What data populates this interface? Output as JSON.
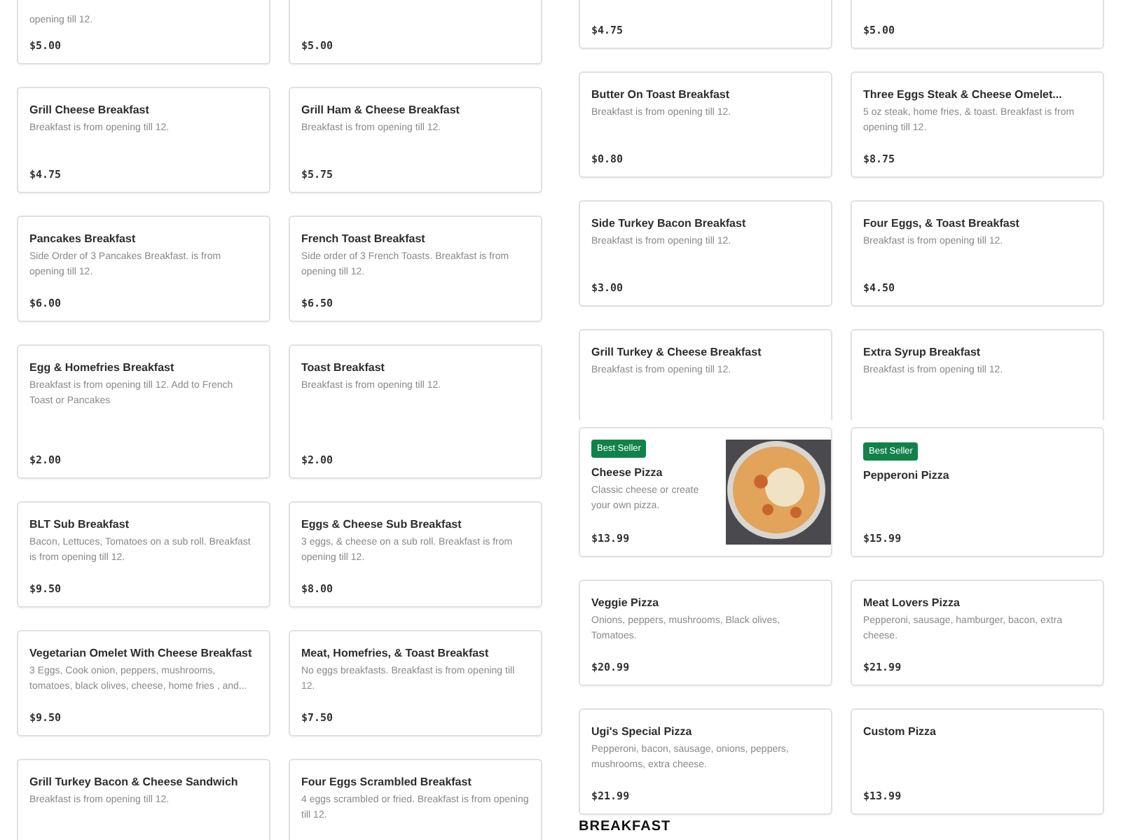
{
  "panels": [
    {
      "cards": [
        {
          "description": "opening till 12.",
          "price": "$5.00",
          "photo": false
        },
        {
          "price": "$5.00",
          "photo": false
        },
        {
          "title": "Grill Cheese Breakfast",
          "description": "Breakfast is from opening till 12.",
          "price": "$4.75",
          "photo": false
        },
        {
          "title": "Grill Ham & Cheese Breakfast",
          "description": "Breakfast is from opening till 12.",
          "price": "$5.75",
          "photo": false
        },
        {
          "title": "Pancakes Breakfast",
          "description": "Side Order of 3 Pancakes Breakfast. is from opening till 12.",
          "price": "$6.00",
          "photo": false
        },
        {
          "title": "French Toast Breakfast",
          "description": "Side order of 3 French Toasts. Breakfast is from opening till 12.",
          "price": "$6.50",
          "photo": false
        },
        {
          "title": "Egg & Homefries Breakfast",
          "description": "Breakfast is from opening till 12. Add to French Toast or Pancakes",
          "photo": false
        },
        {
          "title": "Toast Breakfast",
          "description": "Breakfast is from opening till 12.",
          "photo": false
        }
      ]
    },
    {
      "cards": [
        {
          "price": "$2.00",
          "photo": false
        },
        {
          "price": "$2.00",
          "photo": false
        },
        {
          "title": "BLT Sub Breakfast",
          "description": "Bacon, Lettuces, Tomatoes on a sub roll. Breakfast is from opening till 12.",
          "price": "$9.50",
          "photo": false
        },
        {
          "title": "Eggs & Cheese Sub Breakfast",
          "description": "3 eggs, & cheese on a sub roll. Breakfast is from opening till 12.",
          "price": "$8.00",
          "photo": false
        },
        {
          "title": "Vegetarian Omelet With Cheese Breakfast",
          "description": "3 Eggs, Cook onion, peppers, mushrooms, tomatoes, black olives, cheese, home fries , and...",
          "price": "$9.50",
          "photo": false
        },
        {
          "title": "Meat, Homefries, & Toast Breakfast",
          "description": "No eggs breakfasts. Breakfast is from opening till 12.",
          "price": "$7.50",
          "photo": false
        },
        {
          "title": "Grill Turkey Bacon & Cheese Sandwich",
          "description": "Breakfast is from opening till 12.",
          "photo": false
        },
        {
          "title": "Four Eggs Scrambled Breakfast",
          "description": "4 eggs scrambled or fried. Breakfast is from opening till 12.",
          "photo": false
        }
      ]
    },
    {
      "cards": [
        {
          "price": "$4.75",
          "photo": false
        },
        {
          "price": "$5.00",
          "photo": false
        },
        {
          "title": "Butter On Toast Breakfast",
          "description": "Breakfast is from opening till 12.",
          "price": "$0.80",
          "photo": false
        },
        {
          "title": "Three Eggs Steak & Cheese Omelet...",
          "description": "5 oz steak, home fries, & toast. Breakfast is from opening till 12.",
          "price": "$8.75",
          "photo": false
        },
        {
          "title": "Side Turkey Bacon Breakfast",
          "description": "Breakfast is from opening till 12.",
          "price": "$3.00",
          "photo": false
        },
        {
          "title": "Four Eggs, & Toast Breakfast",
          "description": "Breakfast is from opening till 12.",
          "price": "$4.50",
          "photo": false
        },
        {
          "title": "Grill Turkey & Cheese Breakfast",
          "description": "Breakfast is from opening till 12.",
          "photo": false
        },
        {
          "title": "Extra Syrup Breakfast",
          "description": "Breakfast is from opening till 12.",
          "photo": false
        }
      ]
    },
    {
      "cards": [
        {
          "badge": "Best Seller",
          "title": "Cheese Pizza",
          "description": "Classic cheese or create your own pizza.",
          "price": "$13.99",
          "photo": true
        },
        {
          "badge": "Best Seller",
          "title": "Pepperoni Pizza",
          "price": "$15.99",
          "photo": false
        },
        {
          "title": "Veggie Pizza",
          "description": "Onions, peppers, mushrooms, Black olives, Tomatoes.",
          "price": "$20.99",
          "photo": false
        },
        {
          "title": "Meat Lovers Pizza",
          "description": "Pepperoni, sausage, hamburger, bacon, extra cheese.",
          "price": "$21.99",
          "photo": false
        },
        {
          "title": "Ugi's Special Pizza",
          "description": "Pepperoni, bacon, sausage, onions, peppers, mushrooms, extra cheese.",
          "price": "$21.99",
          "photo": false
        },
        {
          "title": "Custom Pizza",
          "price": "$13.99",
          "photo": false
        }
      ],
      "section_heading": "BREAKFAST"
    }
  ]
}
